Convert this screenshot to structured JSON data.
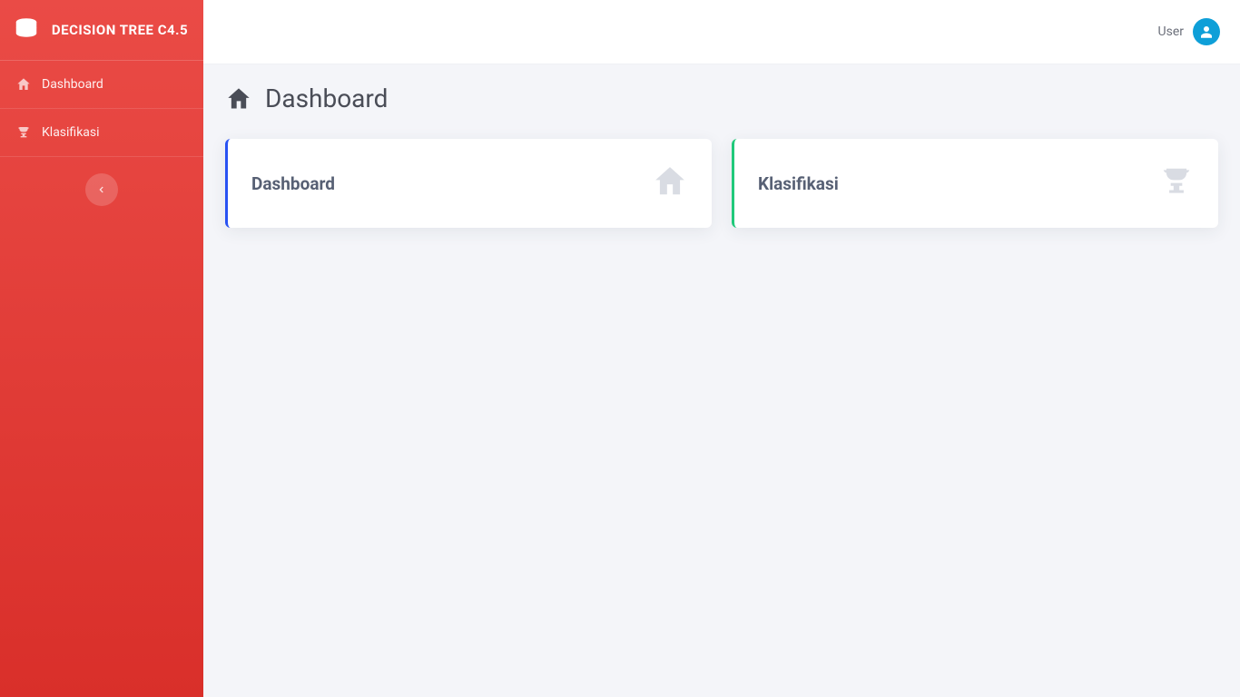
{
  "brand": {
    "title": "DECISION TREE C4.5"
  },
  "sidebar": {
    "items": [
      {
        "label": "Dashboard",
        "icon": "home-icon"
      },
      {
        "label": "Klasifikasi",
        "icon": "trophy-icon"
      }
    ]
  },
  "topbar": {
    "user_label": "User"
  },
  "page": {
    "title": "Dashboard"
  },
  "cards": [
    {
      "title": "Dashboard",
      "icon": "home-icon",
      "accent": "blue"
    },
    {
      "title": "Klasifikasi",
      "icon": "trophy-icon",
      "accent": "green"
    }
  ],
  "colors": {
    "accent_blue": "#2852f2",
    "accent_green": "#20c97a",
    "sidebar_bg": "#e23a36",
    "avatar_bg": "#0e9fd8"
  }
}
